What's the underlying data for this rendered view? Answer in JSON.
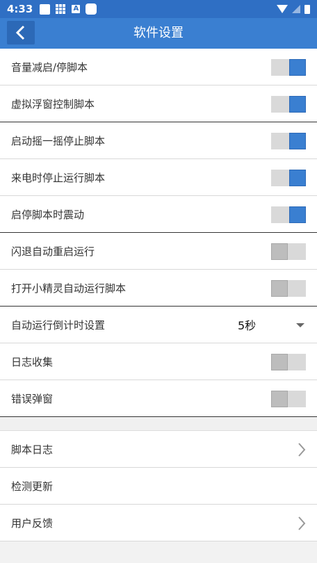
{
  "status": {
    "time": "4:33"
  },
  "header": {
    "title": "软件设置"
  },
  "settings": [
    {
      "label": "音量减启/停脚本",
      "on": true
    },
    {
      "label": "虚拟浮窗控制脚本",
      "on": true
    },
    {
      "label": "启动摇一摇停止脚本",
      "on": true
    },
    {
      "label": "来电时停止运行脚本",
      "on": true
    },
    {
      "label": "启停脚本时震动",
      "on": true
    },
    {
      "label": "闪退自动重启运行",
      "on": false
    },
    {
      "label": "打开小精灵自动运行脚本",
      "on": false
    }
  ],
  "countdown": {
    "label": "自动运行倒计时设置",
    "value": "5秒"
  },
  "extra_settings": [
    {
      "label": "日志收集",
      "on": false
    },
    {
      "label": "错误弹窗",
      "on": false
    }
  ],
  "links": [
    {
      "label": "脚本日志",
      "chevron": true
    },
    {
      "label": "检测更新",
      "chevron": false
    },
    {
      "label": "用户反馈",
      "chevron": true
    }
  ],
  "icons": {
    "back": "chevron-left-icon",
    "chevron": "chevron-right-icon",
    "dropdown": "caret-down-icon"
  },
  "colors": {
    "accent": "#3a7fd1",
    "statusbar": "#2f6fc4",
    "toggle_on": "#3a7fd1",
    "toggle_off": "#bdbdbd"
  }
}
